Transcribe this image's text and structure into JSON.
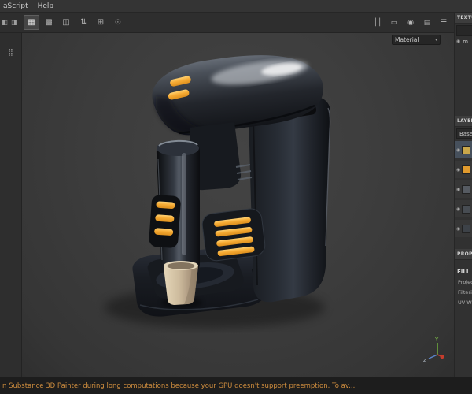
{
  "menu": {
    "items": [
      "aScript",
      "Help"
    ]
  },
  "toolbar": {
    "dock_icons": [
      {
        "name": "dock-left",
        "glyph": "◧"
      },
      {
        "name": "dock-right",
        "glyph": "◨"
      }
    ],
    "left_icons": [
      {
        "name": "grid",
        "glyph": "▦"
      },
      {
        "name": "texel-density",
        "glyph": "▩"
      },
      {
        "name": "symmetry-x",
        "glyph": "◫"
      },
      {
        "name": "symmetry-y",
        "glyph": "⇅"
      },
      {
        "name": "snap",
        "glyph": "⊞"
      },
      {
        "name": "falloff",
        "glyph": "⊙"
      }
    ],
    "right_icons": [
      {
        "name": "pause",
        "glyph": "││"
      },
      {
        "name": "solo-view",
        "glyph": "▭"
      },
      {
        "name": "camera",
        "glyph": "◉"
      },
      {
        "name": "display-settings",
        "glyph": "▤"
      },
      {
        "name": "shader-settings",
        "glyph": "☰"
      }
    ]
  },
  "left_dock": {
    "tools_glyph": "⣿"
  },
  "viewport": {
    "display_mode": "Material",
    "dropdown_caret": "▾",
    "axis": {
      "y_label": "Y",
      "z_label": "z"
    }
  },
  "right_panel": {
    "texture_set": {
      "header": "TEXTURE SET",
      "eye_glyph": "◉",
      "material_label": "m"
    },
    "layers": {
      "header": "LAYERS",
      "channel": "Base",
      "caret": "▾",
      "eye_glyph": "◉",
      "items": [
        {
          "color": "#c9a74a"
        },
        {
          "color": "#e09a2d"
        },
        {
          "color": "#565b62"
        },
        {
          "color": "#474c52"
        },
        {
          "color": "#3d4248"
        }
      ]
    },
    "properties": {
      "header": "PROPERTIES",
      "fill_title": "FILL",
      "rows": [
        "Projection",
        "Filtering",
        "UV Wrap"
      ]
    }
  },
  "status_bar": {
    "message": "n Substance 3D Painter during long computations because your GPU doesn't support preemption. To av..."
  },
  "colors": {
    "accent_yellow": "#f2a52f",
    "status_text": "#cf8d3e",
    "selection": "#46505c",
    "cup": "#cdbb9d",
    "viewport_bg": "#3d3d3d"
  }
}
